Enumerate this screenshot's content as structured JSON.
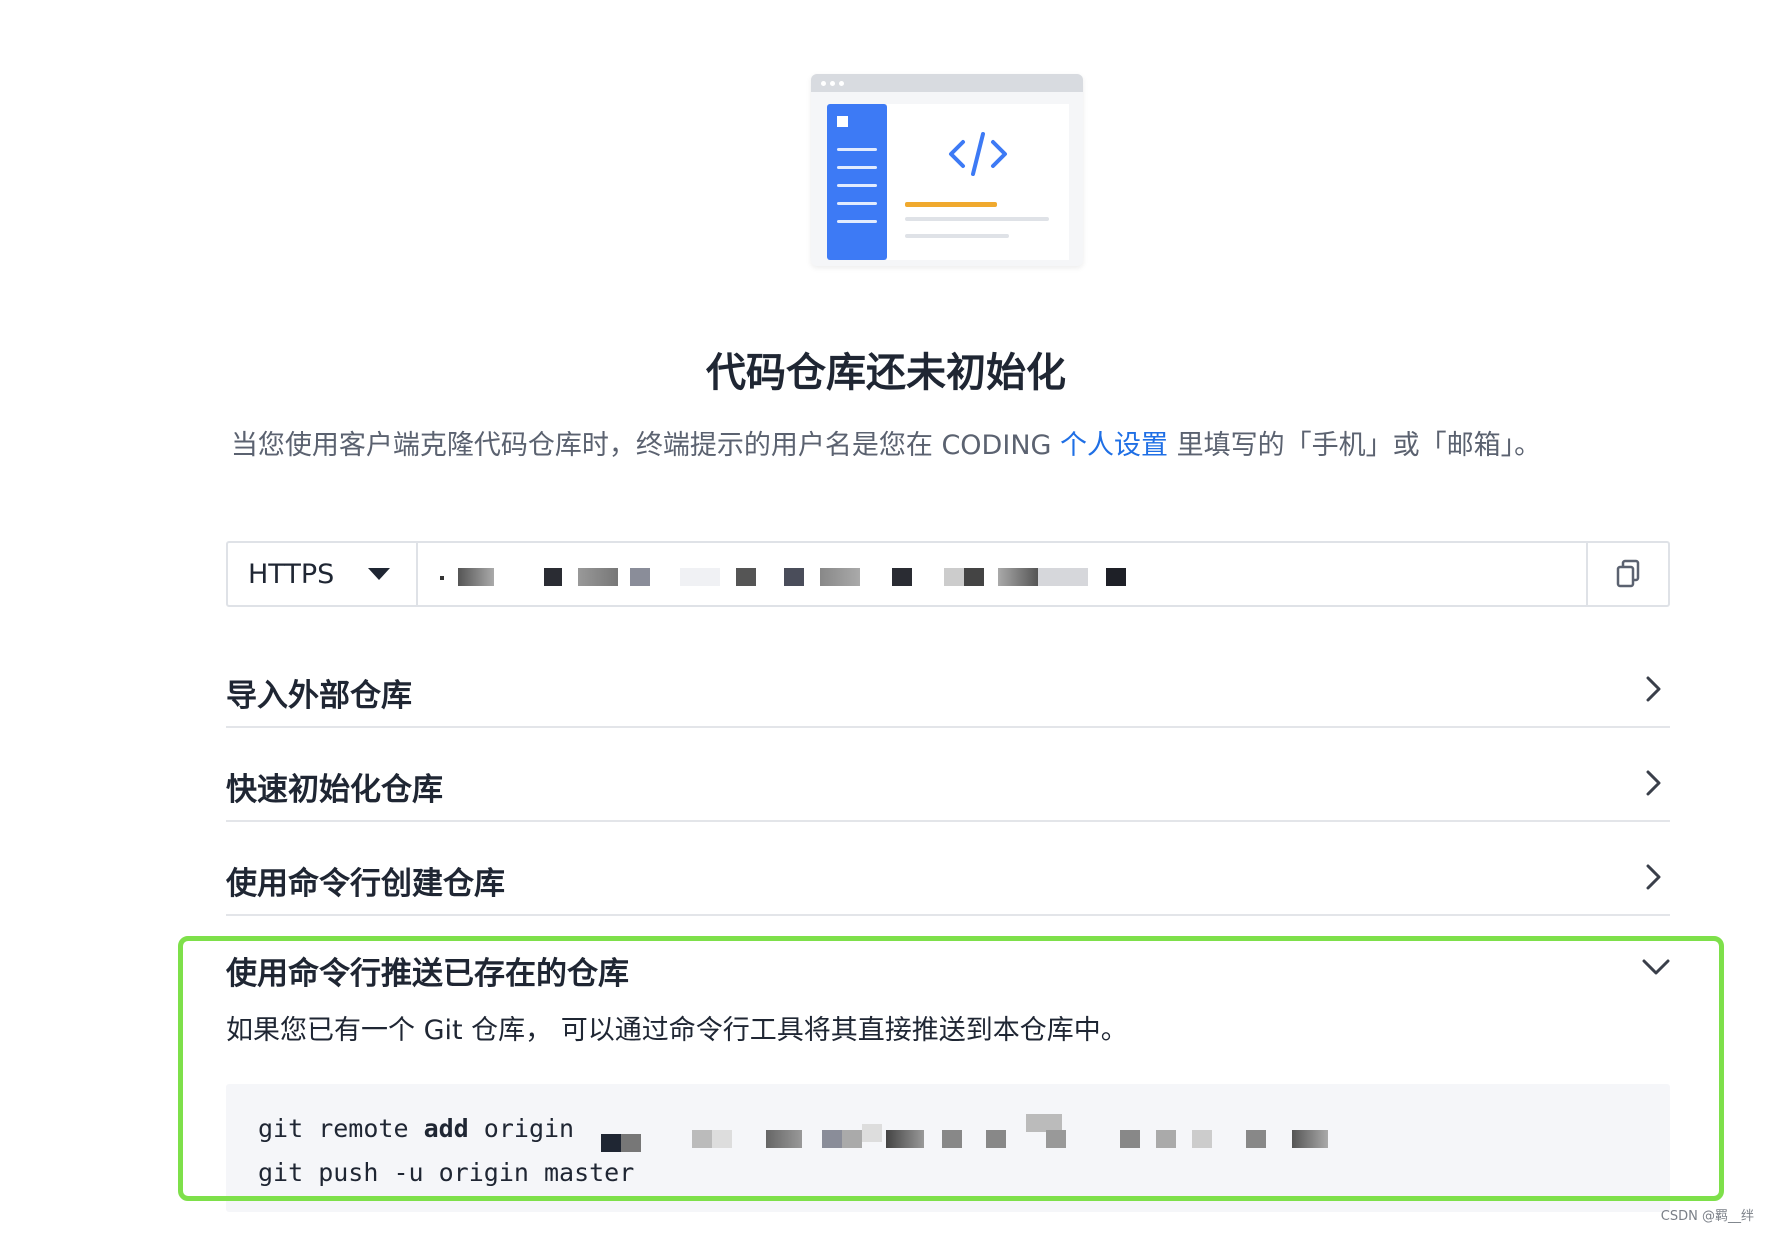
{
  "page": {
    "title": "代码仓库还未初始化",
    "subtitle_before": "当您使用客户端克隆代码仓库时，终端提示的用户名是您在 CODING ",
    "subtitle_link": "个人设置",
    "subtitle_after": " 里填写的「手机」或「邮箱」。"
  },
  "clone": {
    "protocol": "HTTPS"
  },
  "accordion": [
    {
      "label": "导入外部仓库",
      "expanded": false
    },
    {
      "label": "快速初始化仓库",
      "expanded": false
    },
    {
      "label": "使用命令行创建仓库",
      "expanded": false
    },
    {
      "label": "使用命令行推送已存在的仓库",
      "expanded": true
    }
  ],
  "push_section": {
    "description": "如果您已有一个 Git 仓库， 可以通过命令行工具将其直接推送到本仓库中。",
    "line1_prefix": "git remote ",
    "line1_bold": "add",
    "line1_suffix": " origin",
    "line2": "git push -u origin master"
  },
  "watermark": "CSDN @羁__绊",
  "colors": {
    "accent": "#1f6fe5",
    "highlight_border": "#7ee04a",
    "illustration_blue": "#3d7af5",
    "illustration_orange": "#f0a92e"
  }
}
